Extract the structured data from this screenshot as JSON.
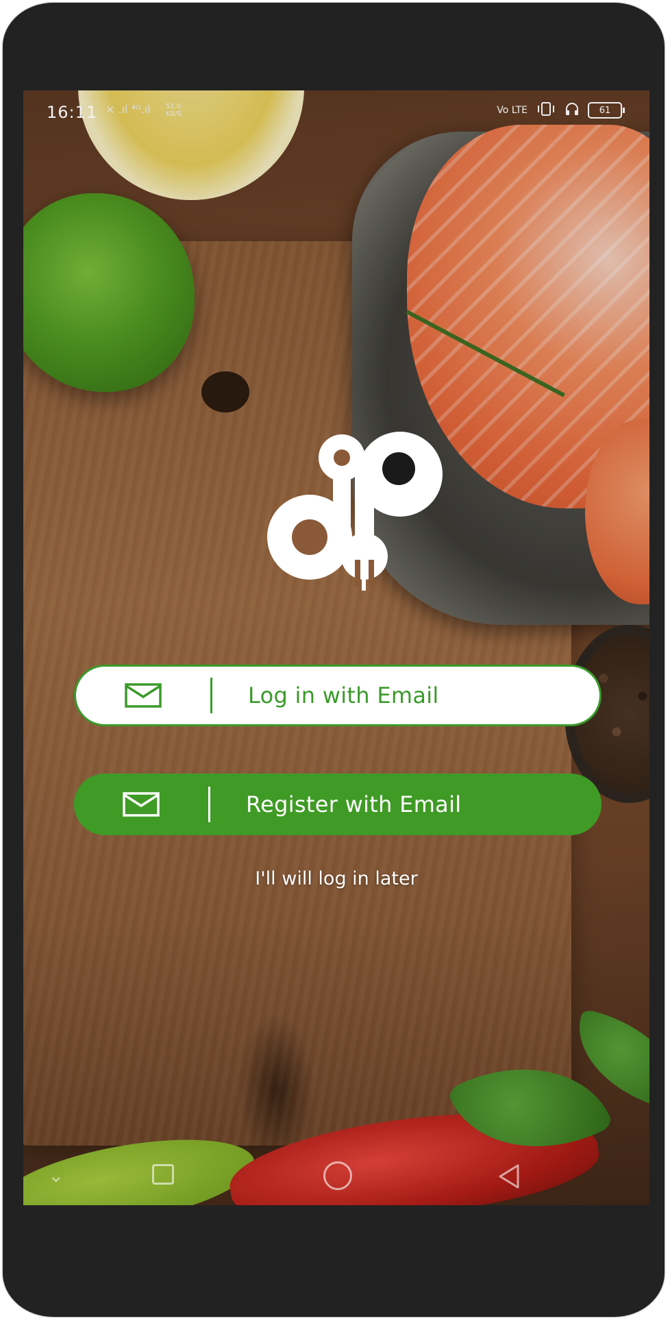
{
  "status_bar": {
    "time": "16:11",
    "signal": "× .ıl ⁴ᴳ.ıl",
    "speed_value": "51.0",
    "speed_unit": "KB/S",
    "network": "Vo LTE",
    "battery": "61"
  },
  "actions": {
    "login_label": "Log in with Email",
    "register_label": "Register with Email",
    "later_label": "I'll will log in later"
  },
  "colors": {
    "brand_green": "#3f9b26",
    "white": "#ffffff",
    "frame": "#222222"
  },
  "icons": {
    "login_icon": "mail-icon",
    "register_icon": "mail-icon",
    "logo": "dp-logo"
  }
}
